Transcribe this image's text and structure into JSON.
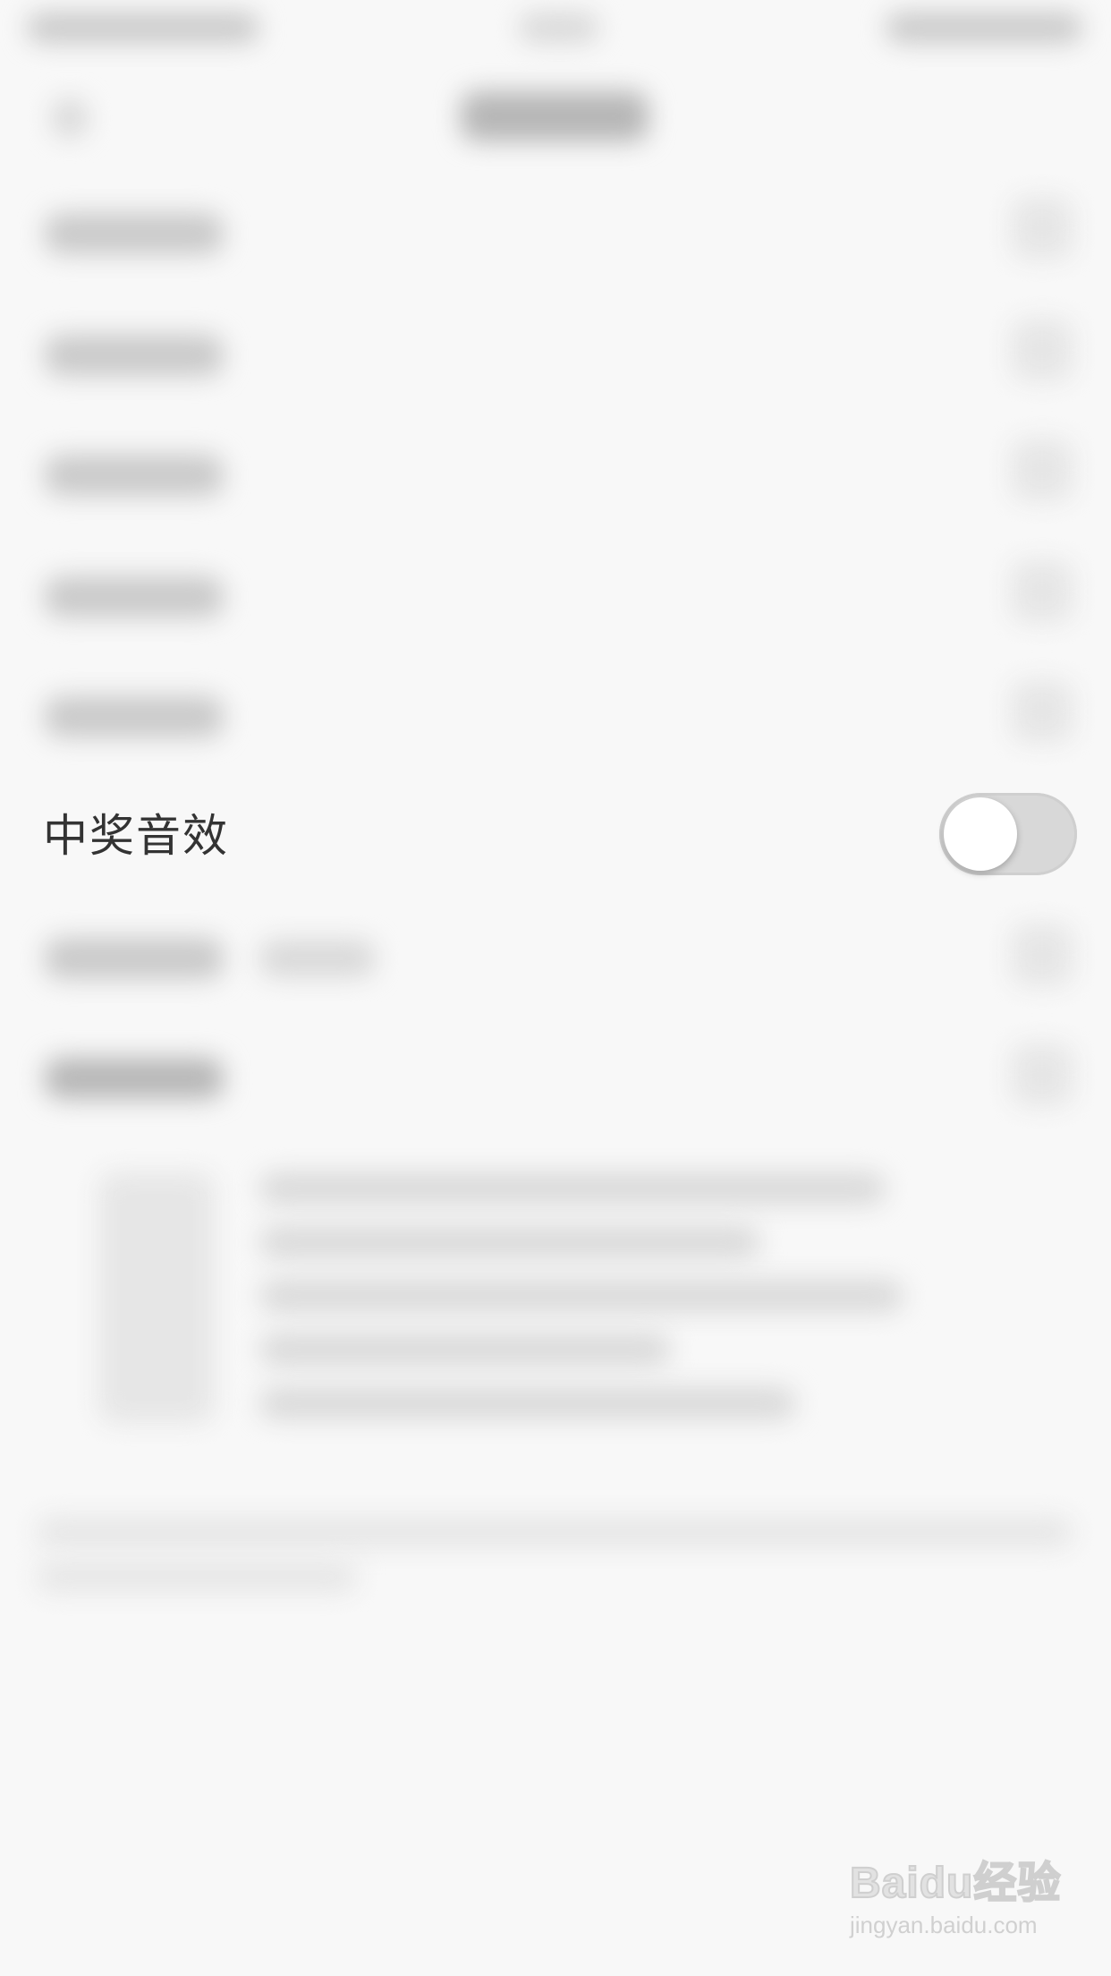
{
  "setting": {
    "label": "中奖音效",
    "toggle_state": "off"
  },
  "watermark": {
    "logo": "Baidu经验",
    "url": "jingyan.baidu.com"
  },
  "colors": {
    "background": "#f8f8f8",
    "label_text": "#333333",
    "toggle_track_off": "#d8d8d8",
    "toggle_knob": "#ffffff"
  }
}
